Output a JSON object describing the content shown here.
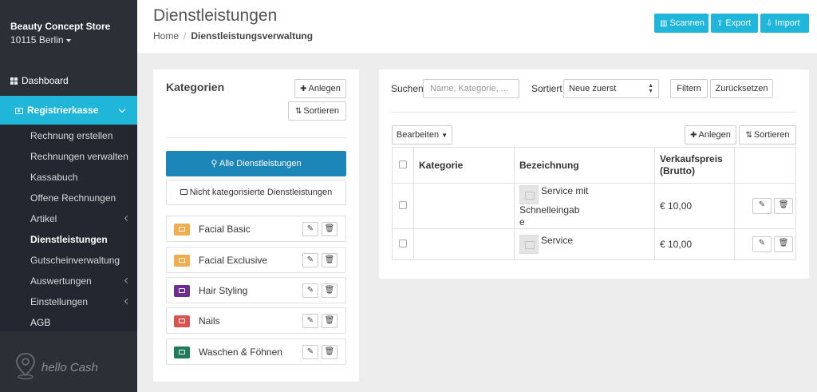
{
  "sidebar": {
    "store_name": "Beauty Concept Store",
    "store_city": "10115 Berlin",
    "dashboard": "Dashboard",
    "kasse": "Registrierkasse",
    "items": [
      {
        "label": "Rechnung erstellen"
      },
      {
        "label": "Rechnungen verwalten"
      },
      {
        "label": "Kassabuch"
      },
      {
        "label": "Offene Rechnungen"
      },
      {
        "label": "Artikel"
      },
      {
        "label": "Dienstleistungen"
      },
      {
        "label": "Gutscheinverwaltung"
      },
      {
        "label": "Auswertungen"
      },
      {
        "label": "Einstellungen"
      }
    ],
    "agb": "AGB",
    "logo_text": "hello Cash"
  },
  "header": {
    "title": "Dienstleistungen",
    "breadcrumb_home": "Home",
    "breadcrumb_sep": "/",
    "breadcrumb_current": "Dienstleistungsverwaltung",
    "btn_scan": "Scannen",
    "btn_export": "Export",
    "btn_import": "Import"
  },
  "categories": {
    "title": "Kategorien",
    "add_label": "Anlegen",
    "sort_label": "Sortieren",
    "all_label": "Alle Dienstleistungen",
    "uncategorized_label": "Nicht kategorisierte Dienstleistungen",
    "items": [
      {
        "label": "Facial Basic",
        "color": "#f0ad4e"
      },
      {
        "label": "Facial Exclusive",
        "color": "#f0ad4e"
      },
      {
        "label": "Hair Styling",
        "color": "#6f2c91"
      },
      {
        "label": "Nails",
        "color": "#d9534f"
      },
      {
        "label": "Waschen & Föhnen",
        "color": "#1e7c5a"
      }
    ]
  },
  "services": {
    "search_label": "Suchen",
    "search_placeholder": "Name, Kategorie, ...",
    "sort_label": "Sortiert",
    "sort_value": "Neue zuerst",
    "filter_btn": "Filtern",
    "reset_btn": "Zurücksetzen",
    "edit_btn": "Bearbeiten",
    "add_btn": "Anlegen",
    "sort_btn": "Sortieren",
    "columns": {
      "category": "Kategorie",
      "name": "Bezeichnung",
      "price_line1": "Verkaufspreis",
      "price_line2": "(Brutto)"
    },
    "rows": [
      {
        "category": "",
        "name_line1": "Service mit Schnelleingab",
        "name_line2": "e",
        "price": "€ 10,00"
      },
      {
        "category": "",
        "name_line1": "Service",
        "name_line2": "",
        "price": "€ 10,00"
      }
    ]
  }
}
